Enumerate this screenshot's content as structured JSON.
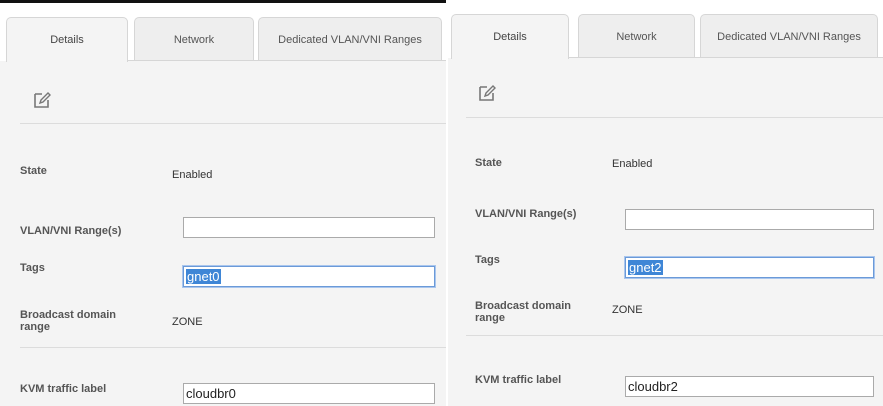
{
  "tabs": [
    "Details",
    "Network",
    "Dedicated VLAN/VNI Ranges"
  ],
  "labels": {
    "state": "State",
    "vlan": "VLAN/VNI Range(s)",
    "tags": "Tags",
    "broadcast_line1": "Broadcast domain",
    "broadcast_line2": "range",
    "kvm": "KVM traffic label"
  },
  "left": {
    "state": "Enabled",
    "vlan": "",
    "tags": "gnet0",
    "broadcast": "ZONE",
    "kvm": "cloudbr0"
  },
  "right": {
    "state": "Enabled",
    "vlan": "",
    "tags": "gnet2",
    "broadcast": "ZONE",
    "kvm": "cloudbr2"
  },
  "icons": {
    "edit": "edit-pencil-icon"
  },
  "colors": {
    "selection": "#3f86d6",
    "panel": "#f4f4f4",
    "focus_border": "#6b9ad8"
  }
}
